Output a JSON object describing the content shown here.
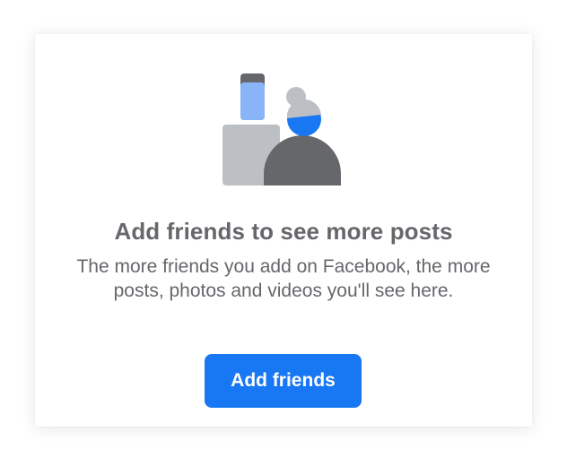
{
  "empty_state": {
    "illustration_icon": "add-friends-illustration-icon",
    "title": "Add friends to see more posts",
    "description": "The more friends you add on Facebook, the more posts, photos and videos you'll see here.",
    "button_label": "Add friends"
  },
  "colors": {
    "accent": "#1877f2",
    "text_secondary": "#65676b",
    "illustration_gray_light": "#bcc0c4",
    "illustration_gray_dark": "#606770",
    "illustration_blue_light": "#8ab4f8"
  }
}
